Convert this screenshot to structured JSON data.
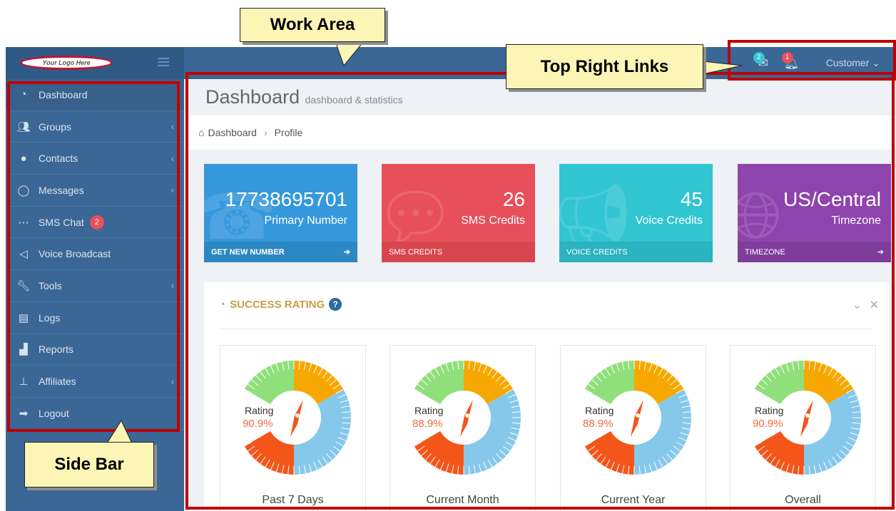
{
  "logo_text": "Your Logo Here",
  "topbar": {
    "messages_badge": "2",
    "notifications_badge": "1",
    "user_menu_label": "Customer",
    "user_menu_caret": "⌄"
  },
  "sidebar": {
    "items": [
      {
        "label": "Dashboard",
        "icon": "tachometer-icon"
      },
      {
        "label": "Groups",
        "icon": "users-icon"
      },
      {
        "label": "Contacts",
        "icon": "user-icon"
      },
      {
        "label": "Messages",
        "icon": "comment-icon"
      },
      {
        "label": "SMS Chat",
        "icon": "chat-icon",
        "badge": "2"
      },
      {
        "label": "Voice Broadcast",
        "icon": "megaphone-icon"
      },
      {
        "label": "Tools",
        "icon": "wrench-icon"
      },
      {
        "label": "Logs",
        "icon": "document-icon"
      },
      {
        "label": "Reports",
        "icon": "bar-chart-icon"
      },
      {
        "label": "Affiliates",
        "icon": "sitemap-icon"
      },
      {
        "label": "Logout",
        "icon": "sign-out-icon"
      }
    ]
  },
  "page": {
    "title": "Dashboard",
    "subtitle": "dashboard & statistics",
    "breadcrumb": [
      "Dashboard",
      "Profile"
    ]
  },
  "stats": [
    {
      "value": "17738695701",
      "label": "Primary Number",
      "footer": "GET NEW NUMBER",
      "color": "#3598dc"
    },
    {
      "value": "26",
      "label": "SMS Credits",
      "footer": "SMS CREDITS",
      "color": "#e7505a"
    },
    {
      "value": "45",
      "label": "Voice Credits",
      "footer": "VOICE CREDITS",
      "color": "#32c5d2"
    },
    {
      "value": "US/Central",
      "label": "Timezone",
      "footer": "TIMEZONE",
      "color": "#8e44ad"
    }
  ],
  "success_rating": {
    "title": "SUCCESS RATING",
    "help_icon": "?",
    "cards": [
      {
        "rating_label": "Rating",
        "rating_value": "90.9%",
        "caption": "Past 7 Days"
      },
      {
        "rating_label": "Rating",
        "rating_value": "88.9%",
        "caption": "Current Month"
      },
      {
        "rating_label": "Rating",
        "rating_value": "88.9%",
        "caption": "Current Year"
      },
      {
        "rating_label": "Rating",
        "rating_value": "90.9%",
        "caption": "Overall"
      }
    ]
  },
  "annotations": {
    "work_area": "Work Area",
    "top_right_links": "Top Right Links",
    "side_bar": "Side Bar"
  }
}
